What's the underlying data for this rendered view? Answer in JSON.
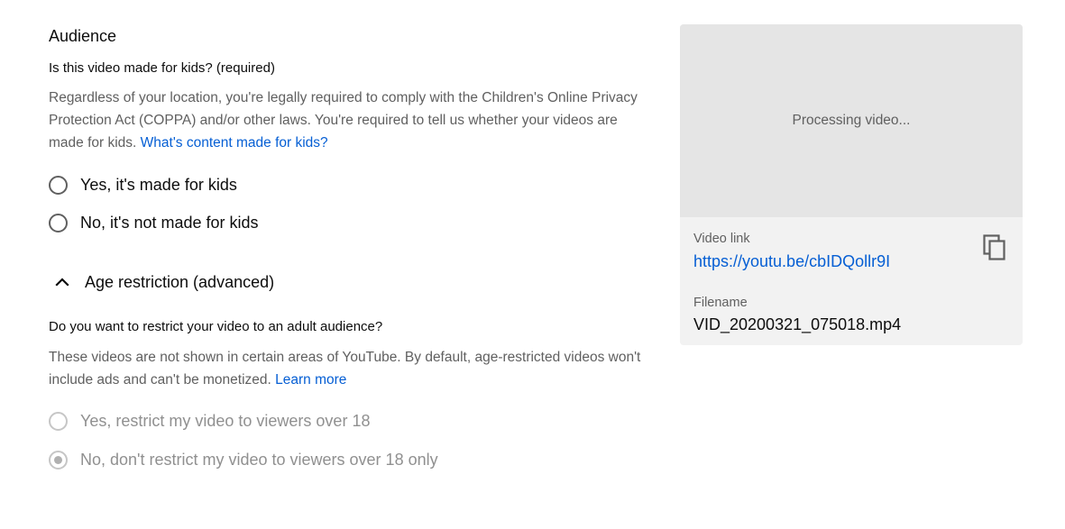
{
  "audience": {
    "title": "Audience",
    "kids_question": "Is this video made for kids? (required)",
    "kids_description": "Regardless of your location, you're legally required to comply with the Children's Online Privacy Protection Act (COPPA) and/or other laws. You're required to tell us whether your videos are made for kids. ",
    "kids_link": "What's content made for kids?",
    "kids_options": [
      {
        "label": "Yes, it's made for kids",
        "selected": false
      },
      {
        "label": "No, it's not made for kids",
        "selected": false
      }
    ]
  },
  "age_restriction": {
    "toggle_label": "Age restriction (advanced)",
    "expanded": true,
    "question": "Do you want to restrict your video to an adult audience?",
    "description": "These videos are not shown in certain areas of YouTube. By default, age-restricted videos won't include ads and can't be monetized. ",
    "learn_more": "Learn more",
    "options": [
      {
        "label": "Yes, restrict my video to viewers over 18",
        "selected": false,
        "disabled": true
      },
      {
        "label": "No, don't restrict my video to viewers over 18 only",
        "selected": true,
        "disabled": true
      }
    ]
  },
  "video_card": {
    "preview_status": "Processing video...",
    "link_label": "Video link",
    "link_url": "https://youtu.be/cbIDQollr9I",
    "filename_label": "Filename",
    "filename": "VID_20200321_075018.mp4",
    "copy_icon": "copy-icon"
  },
  "colors": {
    "link": "#065fd4",
    "secondary_text": "#606060",
    "card_bg": "#f2f2f2",
    "preview_bg": "#e5e5e5"
  }
}
